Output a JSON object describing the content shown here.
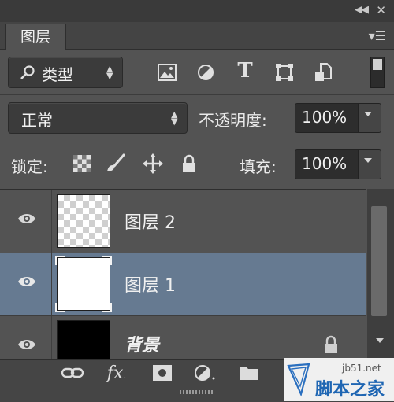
{
  "panel": {
    "tab_label": "图层"
  },
  "filter": {
    "kind_label": "类型",
    "icons": [
      "image-filter-icon",
      "adjustment-filter-icon",
      "type-filter-icon",
      "shape-filter-icon",
      "smartobject-filter-icon"
    ]
  },
  "blend": {
    "mode": "正常",
    "opacity_label": "不透明度:",
    "opacity_value": "100%"
  },
  "lock": {
    "label": "锁定:",
    "fill_label": "填充:",
    "fill_value": "100%"
  },
  "layers": [
    {
      "name": "图层 2",
      "thumb": "transparent",
      "selected": false
    },
    {
      "name": "图层 1",
      "thumb": "white",
      "selected": true
    },
    {
      "name": "背景",
      "thumb": "black",
      "selected": false,
      "locked": true
    }
  ],
  "colors": {
    "panel_bg": "#535353",
    "selected_row": "#667a91",
    "field_bg": "#2d2d2d"
  },
  "watermark": {
    "site": "jb51.net",
    "name": "脚本之家"
  }
}
